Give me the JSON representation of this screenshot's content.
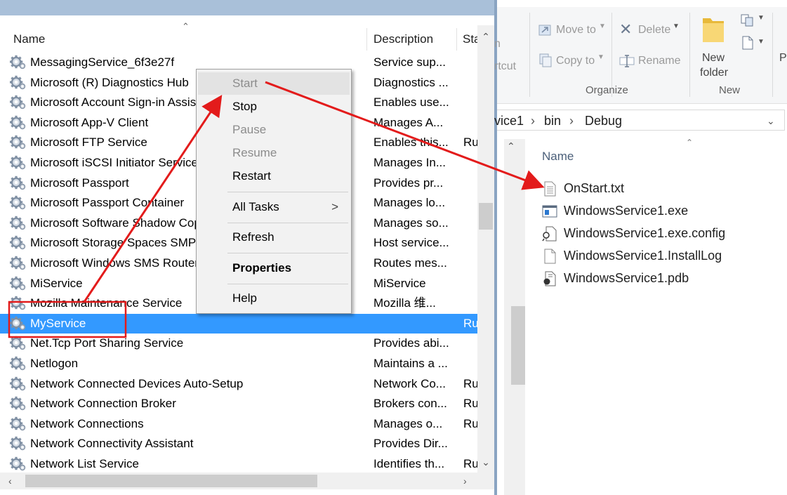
{
  "services": {
    "columns": {
      "name": "Name",
      "description": "Description",
      "status": "Sta"
    },
    "rows": [
      {
        "name": "MessagingService_6f3e27f",
        "description": "Service sup...",
        "status": ""
      },
      {
        "name": "Microsoft (R) Diagnostics Hub",
        "description": "Diagnostics ...",
        "status": ""
      },
      {
        "name": "Microsoft Account Sign-in Assistant",
        "description": "Enables use...",
        "status": ""
      },
      {
        "name": "Microsoft App-V Client",
        "description": "Manages A...",
        "status": ""
      },
      {
        "name": "Microsoft FTP Service",
        "description": "Enables this...",
        "status": "Ru"
      },
      {
        "name": "Microsoft iSCSI Initiator Service",
        "description": "Manages In...",
        "status": ""
      },
      {
        "name": "Microsoft Passport",
        "description": "Provides pr...",
        "status": ""
      },
      {
        "name": "Microsoft Passport Container",
        "description": "Manages lo...",
        "status": ""
      },
      {
        "name": "Microsoft Software Shadow Copy Provider",
        "description": "Manages so...",
        "status": ""
      },
      {
        "name": "Microsoft Storage Spaces SMP",
        "description": "Host service...",
        "status": ""
      },
      {
        "name": "Microsoft Windows SMS Router Service.",
        "description": "Routes mes...",
        "status": ""
      },
      {
        "name": "MiService",
        "description": "MiService",
        "status": ""
      },
      {
        "name": "Mozilla Maintenance Service",
        "description": "Mozilla 维...",
        "status": ""
      },
      {
        "name": "MyService",
        "description": "",
        "status": "Ru"
      },
      {
        "name": "Net.Tcp Port Sharing Service",
        "description": "Provides abi...",
        "status": ""
      },
      {
        "name": "Netlogon",
        "description": "Maintains a ...",
        "status": ""
      },
      {
        "name": "Network Connected Devices Auto-Setup",
        "description": "Network Co...",
        "status": "Ru"
      },
      {
        "name": "Network Connection Broker",
        "description": "Brokers con...",
        "status": "Ru"
      },
      {
        "name": "Network Connections",
        "description": "Manages o...",
        "status": "Ru"
      },
      {
        "name": "Network Connectivity Assistant",
        "description": "Provides Dir...",
        "status": ""
      },
      {
        "name": "Network List Service",
        "description": "Identifies th...",
        "status": "Ru"
      }
    ]
  },
  "context_menu": {
    "start": "Start",
    "stop": "Stop",
    "pause": "Pause",
    "resume": "Resume",
    "restart": "Restart",
    "all_tasks": "All Tasks",
    "refresh": "Refresh",
    "properties": "Properties",
    "help": "Help",
    "submenu_arrow": ">"
  },
  "explorer": {
    "ribbon": {
      "cut_fragment_top": "n",
      "cut_fragment_bottom": "rtcut",
      "move_to": "Move to",
      "copy_to": "Copy to",
      "delete": "Delete",
      "rename": "Rename",
      "new_folder_line1": "New",
      "new_folder_line2": "folder",
      "organize": "Organize",
      "new": "New",
      "properties_fragment": "Pr"
    },
    "breadcrumb": {
      "part1": "vice1",
      "part2": "bin",
      "part3": "Debug"
    },
    "column_name": "Name",
    "files": [
      {
        "name": "OnStart.txt",
        "icon": "text-file-icon"
      },
      {
        "name": "WindowsService1.exe",
        "icon": "exe-file-icon"
      },
      {
        "name": "WindowsService1.exe.config",
        "icon": "config-file-icon"
      },
      {
        "name": "WindowsService1.InstallLog",
        "icon": "blank-file-icon"
      },
      {
        "name": "WindowsService1.pdb",
        "icon": "pdb-file-icon"
      }
    ]
  },
  "colors": {
    "selection": "#3399ff",
    "annotation": "#e31b1b",
    "menu_background": "#f2f2f2"
  }
}
